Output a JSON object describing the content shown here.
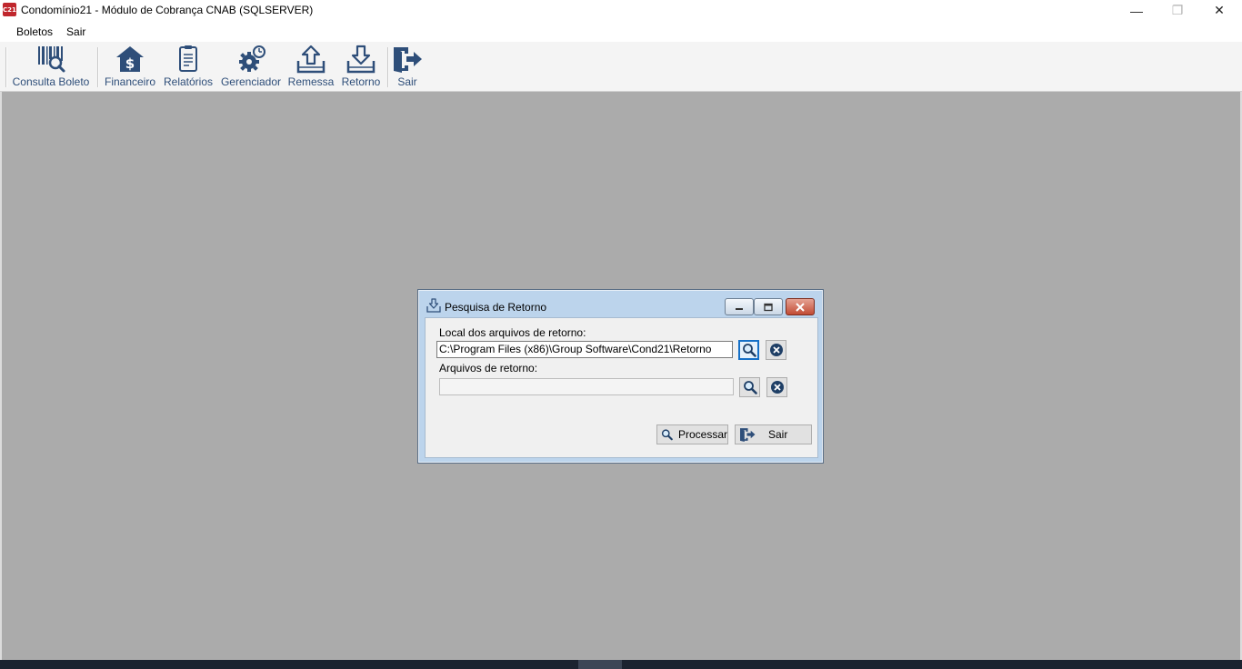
{
  "window": {
    "icon_text": "C21",
    "title": "Condomínio21 - Módulo de Cobrança CNAB (SQLSERVER)",
    "minimize": "—",
    "restore": "❐",
    "close": "✕"
  },
  "menu": [
    "Boletos",
    "Sair"
  ],
  "toolbar": {
    "items": [
      {
        "label": "Consulta Boleto",
        "icon": "barcode-search-icon"
      },
      {
        "label": "Financeiro",
        "icon": "house-dollar-icon"
      },
      {
        "label": "Relatórios",
        "icon": "report-icon"
      },
      {
        "label": "Gerenciador",
        "icon": "gear-settings-icon"
      },
      {
        "label": "Remessa",
        "icon": "upload-tray-icon"
      },
      {
        "label": "Retorno",
        "icon": "download-tray-icon"
      },
      {
        "label": "Sair",
        "icon": "exit-door-icon"
      }
    ]
  },
  "dialog": {
    "title": "Pesquisa de Retorno",
    "local_label": "Local dos arquivos de retorno:",
    "local_value": "C:\\Program Files (x86)\\Group Software\\Cond21\\Retorno",
    "files_label": "Arquivos de retorno:",
    "files_value": "",
    "process_label": "Processar",
    "exit_label": "Sair"
  },
  "colors": {
    "accent": "#2e4e79",
    "mdi_background": "#ababab",
    "dialog_frame": "#bcd4ec",
    "clear_button": "#1f3f66"
  }
}
